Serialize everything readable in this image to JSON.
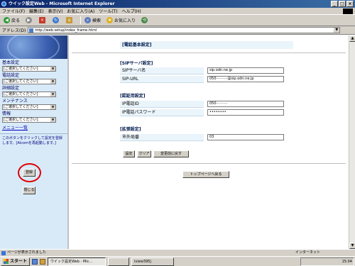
{
  "window": {
    "title": "ウイック設定Web - Microsoft Internet Explorer",
    "controls": [
      "_",
      "□",
      "×"
    ]
  },
  "menu": [
    "ファイル(F)",
    "編集(E)",
    "表示(V)",
    "お気に入り(A)",
    "ツール(T)",
    "ヘルプ(H)"
  ],
  "toolbar": {
    "back": "戻る",
    "search": "検索",
    "favorites": "お気に入り"
  },
  "address": {
    "label": "アドレス(D)",
    "url": "http://web.setup/index_frame.html"
  },
  "sidebar": {
    "groups": [
      {
        "label": "基本設定",
        "select": "[ご選択してください]"
      },
      {
        "label": "電話設定",
        "select": "[ご選択してください]"
      },
      {
        "label": "詳細設定",
        "select": "[ご選択してください]"
      },
      {
        "label": "メンテナンス",
        "select": "[ご選択してください]"
      },
      {
        "label": "情報",
        "select": "[ご選択してください]"
      }
    ],
    "menu_link": "メニュー一覧",
    "notice": "このボタンをクリックして設定を登録します。[Alcomを再起動します。]",
    "register": "登録",
    "close": "閉じる"
  },
  "main": {
    "header": "[電話基本設定]",
    "sip_section": "[SIPサーバ設定]",
    "sip_rows": [
      {
        "label": "SIPサーバ名",
        "value": "sip.odn.ne.jp"
      },
      {
        "label": "SIP-URL",
        "value": "050··········@sip.odn.ne.jp"
      }
    ],
    "auth_section": "[認証用設定]",
    "auth_rows": [
      {
        "label": "IP電話ID",
        "value": "050··········"
      },
      {
        "label": "IP電話パスワード",
        "value": "••••••••"
      }
    ],
    "local_section": "[拡張設定]",
    "local_rows": [
      {
        "label": "市外局番",
        "value": "03"
      }
    ],
    "buttons": {
      "set": "設定",
      "clear": "クリア",
      "revert": "変更前に戻す"
    },
    "top_button": "トップページへ戻る"
  },
  "statusbar": {
    "text": "ページが表示されました",
    "zone": "インターネット"
  },
  "taskbar": {
    "start": "スタート",
    "tasks": [
      "ウイック設定Web - Mic...",
      "",
      "iview395j"
    ],
    "clock": "15:04"
  }
}
